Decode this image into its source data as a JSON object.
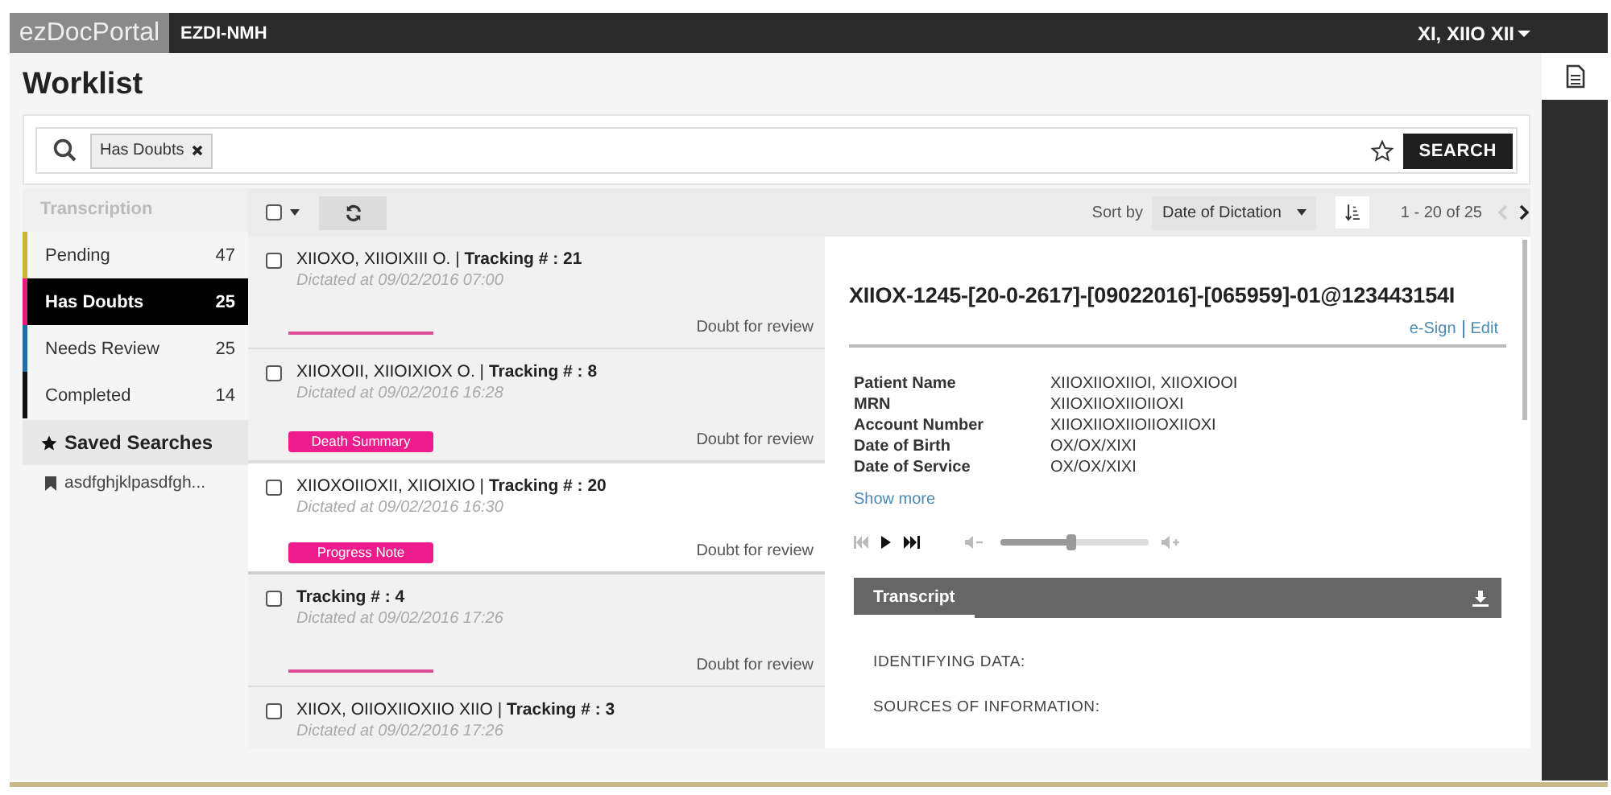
{
  "header": {
    "logo": "ezDocPortal",
    "facility": "EZDI-NMH",
    "user": "XI, XIIO XII"
  },
  "page_title": "Worklist",
  "search": {
    "chips": [
      {
        "label": "Has Doubts"
      }
    ],
    "button": "SEARCH"
  },
  "sidebar": {
    "section": "Transcription",
    "items": [
      {
        "label": "Pending",
        "count": "47",
        "color": "#c8b53c",
        "selected": false
      },
      {
        "label": "Has Doubts",
        "count": "25",
        "color": "#e6197d",
        "selected": true
      },
      {
        "label": "Needs Review",
        "count": "25",
        "color": "#1f6fa8",
        "selected": false
      },
      {
        "label": "Completed",
        "count": "14",
        "color": "#111111",
        "selected": false
      }
    ],
    "saved_title": "Saved Searches",
    "saved": [
      {
        "label": "asdfghjklpasdfgh..."
      }
    ]
  },
  "toolbar": {
    "sort_label": "Sort by",
    "sort_value": "Date of Dictation",
    "range": "1 - 20 of 25",
    "prev": {
      "disabled": true
    },
    "next": {
      "disabled": false
    }
  },
  "documents": [
    {
      "title": "XIIOXO, XIIOIXIII O. | **Tracking # : 21**",
      "dictated": "Dictated at 09/02/2016 07:00",
      "status": "Doubt for review",
      "checked": false,
      "selected": false
    },
    {
      "title": "XIIOXOII, XIIOIXIOX O. | **Tracking # : 8**",
      "dictated": "Dictated at 09/02/2016 16:28",
      "tag": "Death Summary",
      "status": "Doubt for review",
      "checked": false,
      "selected": false
    },
    {
      "title": "XIIOXOIIOXII, XIIOIXIO  | **Tracking # : 20**",
      "dictated": "Dictated at 09/02/2016 16:30",
      "tag": "Progress Note",
      "status": "Doubt for review",
      "checked": false,
      "selected": true
    },
    {
      "title": "**Tracking # : 4**",
      "dictated": "Dictated at 09/02/2016 17:26",
      "status": "Doubt for review",
      "checked": false,
      "selected": false
    },
    {
      "title": "XIIOX, OIIOXIIOXIIO XIIO | **Tracking # : 3**",
      "dictated": "Dictated at 09/02/2016 17:26",
      "checked": false,
      "selected": false
    }
  ],
  "detail": {
    "title": "XIIOX-1245-[20-0-2617]-[09022016]-[065959]-01@123443154I",
    "actions": [
      "e-Sign",
      "Edit"
    ],
    "fields": [
      {
        "label": "Patient Name",
        "value": "XIIOXIIOXIIOI, XIIOXIOOI"
      },
      {
        "label": "MRN",
        "value": "XIIOXIIOXIIOIIOXI"
      },
      {
        "label": "Account Number",
        "value": "XIIOXIIOXIIOIIOXIIOXI"
      },
      {
        "label": "Date of Birth",
        "value": "OX/OX/XIXI"
      },
      {
        "label": "Date of Service",
        "value": "OX/OX/XIXI"
      }
    ],
    "show_more": "Show more",
    "player": {
      "level": 0.48
    },
    "transcript": {
      "tab": "Transcript",
      "lines": [
        "IDENTIFYING DATA:",
        "SOURCES OF INFORMATION:"
      ]
    }
  }
}
